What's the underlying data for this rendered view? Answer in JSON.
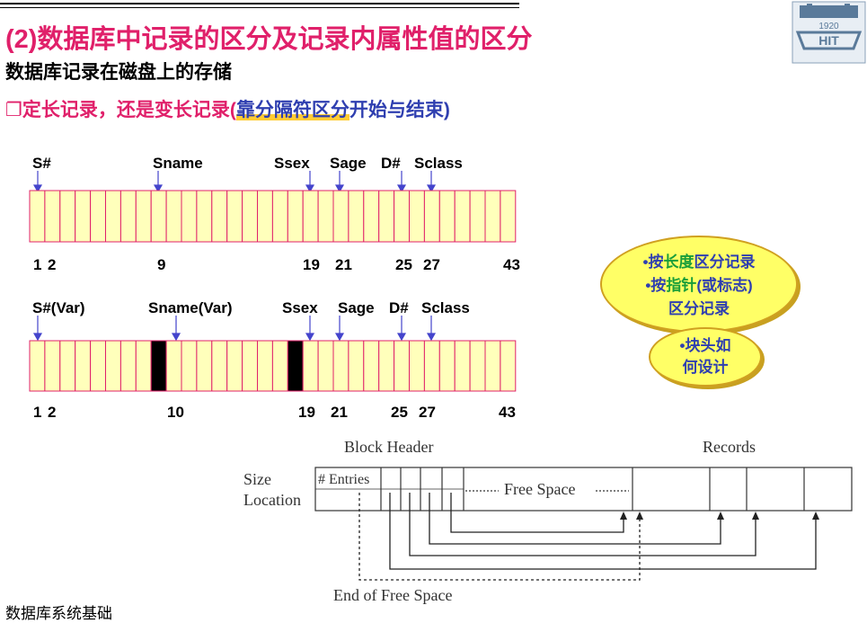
{
  "slide": {
    "title": "(2)数据库中记录的区分及记录内属性值的区分",
    "subtitle": "数据库记录在磁盘上的存储",
    "bullet": {
      "marker": "❐",
      "prefix": "定长记录，还是变长记录(",
      "highlight": "靠分隔符区分",
      "suffix": "开始与结束)"
    },
    "footer": "数据库系统基础"
  },
  "logo": {
    "text": "HIT",
    "year": "1920"
  },
  "fixed_record": {
    "labels": [
      "S#",
      "Sname",
      "Ssex",
      "Sage",
      "D#",
      "Sclass"
    ],
    "positions": [
      "1",
      "2",
      "9",
      "19",
      "21",
      "25",
      "27",
      "43"
    ]
  },
  "variable_record": {
    "labels": [
      "S#(Var)",
      "Sname(Var)",
      "Ssex",
      "Sage",
      "D#",
      "Sclass"
    ],
    "positions": [
      "1",
      "2",
      "10",
      "19",
      "21",
      "25",
      "27",
      "43"
    ]
  },
  "callouts": {
    "big": {
      "line1_prefix": "•按",
      "line1_green": "长度",
      "line1_suffix": "区分记录",
      "line2_prefix": "•按",
      "line2_green": "指针",
      "line2_suffix": "(或标志)",
      "line3": "区分记录"
    },
    "small": {
      "line1": "•块头如",
      "line2": "何设计"
    }
  },
  "block_diagram": {
    "block_header": "Block Header",
    "records": "Records",
    "size": "Size",
    "location": "Location",
    "entries": "# Entries",
    "free_space": "Free Space",
    "end_of_free_space": "End of Free Space"
  },
  "colors": {
    "title": "#e0206a",
    "accent_blue": "#2f3fb0",
    "cell_fill": "#ffffbb",
    "cell_border": "#e0206a",
    "arrow": "#4444cc",
    "callout_fill": "#ffff66",
    "callout_green": "#1a9e3a"
  }
}
